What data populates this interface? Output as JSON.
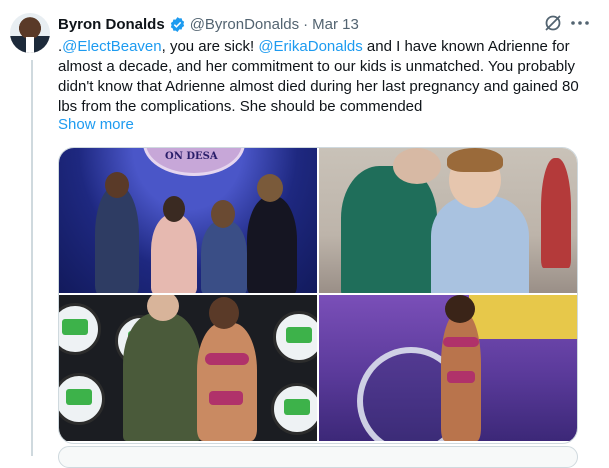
{
  "author": {
    "name": "Byron Donalds",
    "handle": "@ByronDonalds",
    "separator": "·",
    "date": "Mar 13"
  },
  "tweet": {
    "segments": [
      {
        "text": ".",
        "link": false
      },
      {
        "text": "@ElectBeaven",
        "link": true
      },
      {
        "text": ", you are sick! ",
        "link": false
      },
      {
        "text": "@ErikaDonalds",
        "link": true
      },
      {
        "text": " and I have known Adrienne for almost a decade, and her commitment to our kids is unmatched. You probably didn't know that Adrienne almost died during her last pregnancy and gained 80 lbs from the complications. She should be commended",
        "link": false
      }
    ],
    "show_more": "Show more"
  },
  "media": {
    "seal_text": "ON DESA",
    "photos": [
      {
        "name": "gala-photo"
      },
      {
        "name": "boy-woman-photo"
      },
      {
        "name": "competitor-man-photo"
      },
      {
        "name": "stage-photo"
      }
    ]
  },
  "icons": {
    "verified": "verified-badge-icon",
    "grok": "grok-icon",
    "more": "more-icon"
  },
  "colors": {
    "link": "#1d9bf0",
    "secondary_text": "#536471",
    "verified": "#1d9bf0"
  }
}
